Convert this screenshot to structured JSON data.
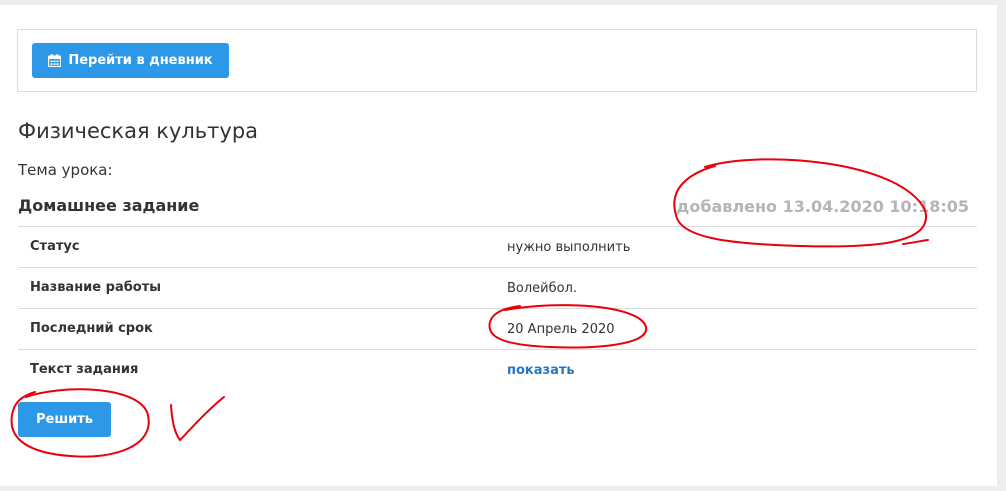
{
  "toolbar": {
    "diary_button_label": "Перейти в дневник",
    "diary_button_icon": "calendar-icon"
  },
  "lesson": {
    "subject": "Физическая культура",
    "topic_label": "Тема урока:"
  },
  "homework": {
    "heading": "Домашнее задание",
    "added": "добавлено 13.04.2020 10:18:05",
    "rows": [
      {
        "label": "Статус",
        "value": "нужно выполнить"
      },
      {
        "label": "Название работы",
        "value": "Волейбол."
      },
      {
        "label": "Последний срок",
        "value": "20 Апрель 2020"
      },
      {
        "label": "Текст задания",
        "value": "показать"
      }
    ],
    "solve_button_label": "Решить"
  },
  "colors": {
    "accent": "#2e98e8",
    "link": "#2479be",
    "muted": "#b5b5b5",
    "annotation": "#e8000b"
  }
}
